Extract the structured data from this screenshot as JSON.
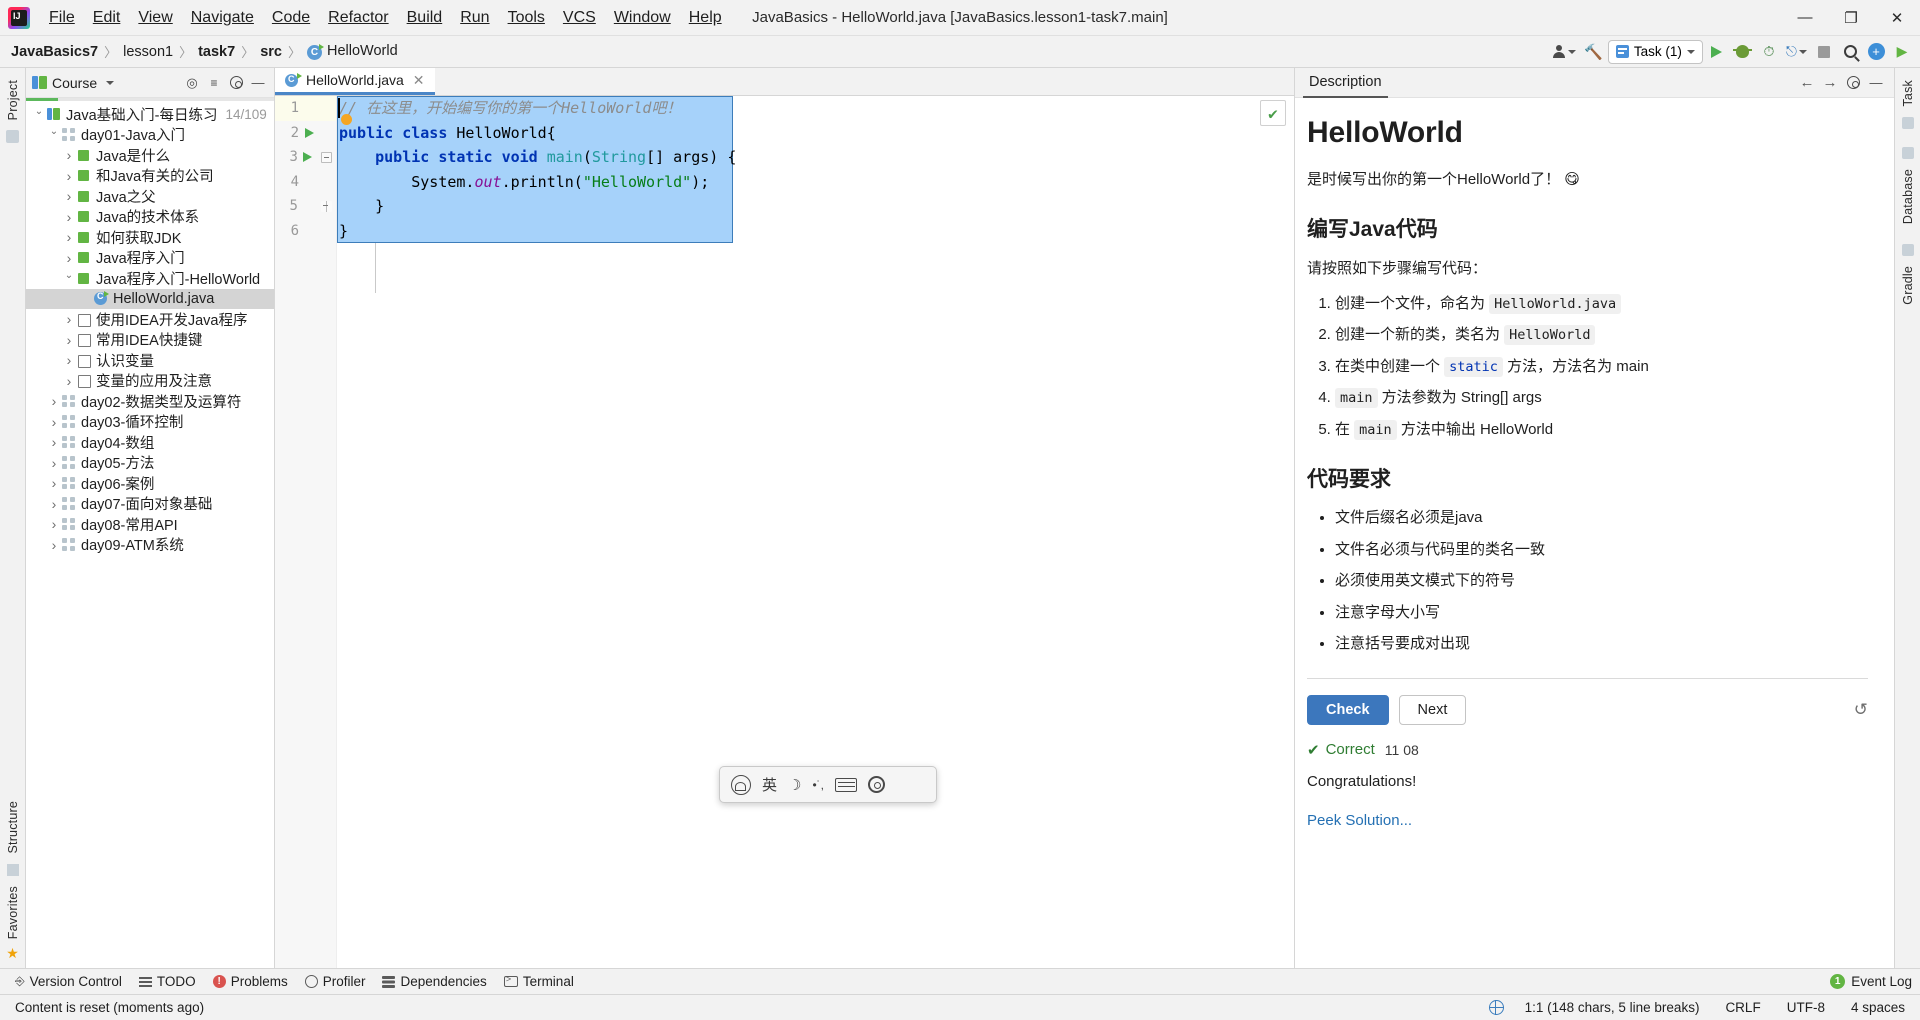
{
  "window": {
    "title": "JavaBasics - HelloWorld.java [JavaBasics.lesson1-task7.main]",
    "minimize": "—",
    "maximize": "❐",
    "close": "✕"
  },
  "menubar": {
    "items": [
      "File",
      "Edit",
      "View",
      "Navigate",
      "Code",
      "Refactor",
      "Build",
      "Run",
      "Tools",
      "VCS",
      "Window",
      "Help"
    ]
  },
  "breadcrumbs": {
    "items": [
      "JavaBasics7",
      "lesson1",
      "task7",
      "src",
      "HelloWorld"
    ],
    "separator": "〉"
  },
  "toolbar": {
    "run_config": "Task (1)",
    "account_label": "account",
    "build_label": "build",
    "run_label": "run",
    "debug_label": "debug",
    "coverage_label": "run-with-coverage",
    "stop_label": "stop",
    "search_label": "search-everywhere",
    "add_label": "add",
    "updates_label": "updates"
  },
  "left_rail": {
    "top_label": "Project",
    "bottom_labels": [
      "Structure",
      "Favorites"
    ]
  },
  "right_rail": {
    "labels": [
      "Task",
      "Database",
      "Gradle"
    ]
  },
  "project_panel": {
    "title": "Course",
    "progress_percent": 13,
    "settings_label": "settings",
    "collapse_label": "collapse-all",
    "locate_label": "select-opened-file",
    "tree": [
      {
        "indent": 1,
        "arrow": "open",
        "icon": "book",
        "label": "Java基础入门-每日练习",
        "count": "14/109",
        "selected": false
      },
      {
        "indent": 2,
        "arrow": "open",
        "icon": "grid",
        "label": "day01-Java入门",
        "count": "",
        "selected": false
      },
      {
        "indent": 3,
        "arrow": "closed",
        "icon": "green",
        "label": "Java是什么",
        "count": "",
        "selected": false
      },
      {
        "indent": 3,
        "arrow": "closed",
        "icon": "green",
        "label": "和Java有关的公司",
        "count": "",
        "selected": false
      },
      {
        "indent": 3,
        "arrow": "closed",
        "icon": "green",
        "label": "Java之父",
        "count": "",
        "selected": false
      },
      {
        "indent": 3,
        "arrow": "closed",
        "icon": "green",
        "label": "Java的技术体系",
        "count": "",
        "selected": false
      },
      {
        "indent": 3,
        "arrow": "closed",
        "icon": "green",
        "label": "如何获取JDK",
        "count": "",
        "selected": false
      },
      {
        "indent": 3,
        "arrow": "closed",
        "icon": "green",
        "label": "Java程序入门",
        "count": "",
        "selected": false
      },
      {
        "indent": 3,
        "arrow": "open",
        "icon": "green",
        "label": "Java程序入门-HelloWorld",
        "count": "",
        "selected": false
      },
      {
        "indent": 4,
        "arrow": "none",
        "icon": "java",
        "label": "HelloWorld.java",
        "count": "",
        "selected": true
      },
      {
        "indent": 3,
        "arrow": "closed",
        "icon": "box",
        "label": "使用IDEA开发Java程序",
        "count": "",
        "selected": false
      },
      {
        "indent": 3,
        "arrow": "closed",
        "icon": "box",
        "label": "常用IDEA快捷键",
        "count": "",
        "selected": false
      },
      {
        "indent": 3,
        "arrow": "closed",
        "icon": "box",
        "label": "认识变量",
        "count": "",
        "selected": false
      },
      {
        "indent": 3,
        "arrow": "closed",
        "icon": "box",
        "label": "变量的应用及注意",
        "count": "",
        "selected": false
      },
      {
        "indent": 2,
        "arrow": "closed",
        "icon": "grid",
        "label": "day02-数据类型及运算符",
        "count": "",
        "selected": false
      },
      {
        "indent": 2,
        "arrow": "closed",
        "icon": "grid",
        "label": "day03-循环控制",
        "count": "",
        "selected": false
      },
      {
        "indent": 2,
        "arrow": "closed",
        "icon": "grid",
        "label": "day04-数组",
        "count": "",
        "selected": false
      },
      {
        "indent": 2,
        "arrow": "closed",
        "icon": "grid",
        "label": "day05-方法",
        "count": "",
        "selected": false
      },
      {
        "indent": 2,
        "arrow": "closed",
        "icon": "grid",
        "label": "day06-案例",
        "count": "",
        "selected": false
      },
      {
        "indent": 2,
        "arrow": "closed",
        "icon": "grid",
        "label": "day07-面向对象基础",
        "count": "",
        "selected": false
      },
      {
        "indent": 2,
        "arrow": "closed",
        "icon": "grid",
        "label": "day08-常用API",
        "count": "",
        "selected": false
      },
      {
        "indent": 2,
        "arrow": "closed",
        "icon": "grid",
        "label": "day09-ATM系统",
        "count": "",
        "selected": false
      }
    ]
  },
  "editor": {
    "tab_label": "HelloWorld.java",
    "tab_close": "✕",
    "line_numbers": [
      "1",
      "2",
      "3",
      "4",
      "5",
      "6"
    ],
    "code_lines": [
      {
        "n": 1,
        "text": "// 在这里，开始编写你的第一个HelloWorld吧！"
      },
      {
        "n": 2,
        "text": "public class HelloWorld{"
      },
      {
        "n": 3,
        "text": "    public static void main(String[] args) {"
      },
      {
        "n": 4,
        "text": "        System.out.println(\"HelloWorld\");"
      },
      {
        "n": 5,
        "text": "    }"
      },
      {
        "n": 6,
        "text": "}"
      }
    ],
    "check_mark": "✔"
  },
  "description": {
    "tab": "Description",
    "title": "HelloWorld",
    "intro": "是时候写出你的第一个HelloWorld了！ 😋",
    "section1_heading": "编写Java代码",
    "section1_lead": "请按照如下步骤编写代码：",
    "steps": [
      {
        "pre": "创建一个文件，命名为 ",
        "code": "HelloWorld.java",
        "post": "",
        "code_kw": false
      },
      {
        "pre": "创建一个新的类，类名为 ",
        "code": "HelloWorld",
        "post": "",
        "code_kw": false
      },
      {
        "pre": "在类中创建一个 ",
        "code": "static",
        "post": " 方法，方法名为 main",
        "code_kw": true
      },
      {
        "pre": "",
        "code": "main",
        "post": " 方法参数为 String[] args",
        "code_kw": false
      },
      {
        "pre": "在 ",
        "code": "main",
        "post": " 方法中输出 HelloWorld",
        "code_kw": false
      }
    ],
    "section2_heading": "代码要求",
    "requirements": [
      "文件后缀名必须是java",
      "文件名必须与代码里的类名一致",
      "必须使用英文模式下的符号",
      "注意字母大小写",
      "注意括号要成对出现"
    ],
    "check_button": "Check",
    "next_button": "Next",
    "reset_icon": "↺",
    "status_text": "Correct",
    "status_time": "11 08",
    "status_check": "✔",
    "congrats": "Congratulations!",
    "peek_link": "Peek Solution..."
  },
  "ime_bar": {
    "logo_label": "sogou-logo",
    "mode": "英",
    "moon": "☽",
    "dots": "•˙,",
    "keyboard_label": "keyboard-icon",
    "settings_label": "settings-icon"
  },
  "bottom_toolbar": {
    "items": [
      {
        "label": "Version Control",
        "icon": "branch-icon"
      },
      {
        "label": "TODO",
        "icon": "todo-icon"
      },
      {
        "label": "Problems",
        "icon": "problems-icon"
      },
      {
        "label": "Profiler",
        "icon": "profiler-icon"
      },
      {
        "label": "Dependencies",
        "icon": "dependencies-icon"
      },
      {
        "label": "Terminal",
        "icon": "terminal-icon"
      }
    ],
    "event_log": "Event Log",
    "event_count": "1"
  },
  "statusbar": {
    "message": "Content is reset (moments ago)",
    "caret": "1:1 (148 chars, 5 line breaks)",
    "line_sep": "CRLF",
    "encoding": "UTF-8",
    "indent": "4 spaces",
    "lang_icon": "globe-icon"
  },
  "colors": {
    "accent": "#3c77bd",
    "selection": "#a6d2fa",
    "green": "#62b543",
    "keyword": "#0033b3",
    "string": "#067d17"
  }
}
